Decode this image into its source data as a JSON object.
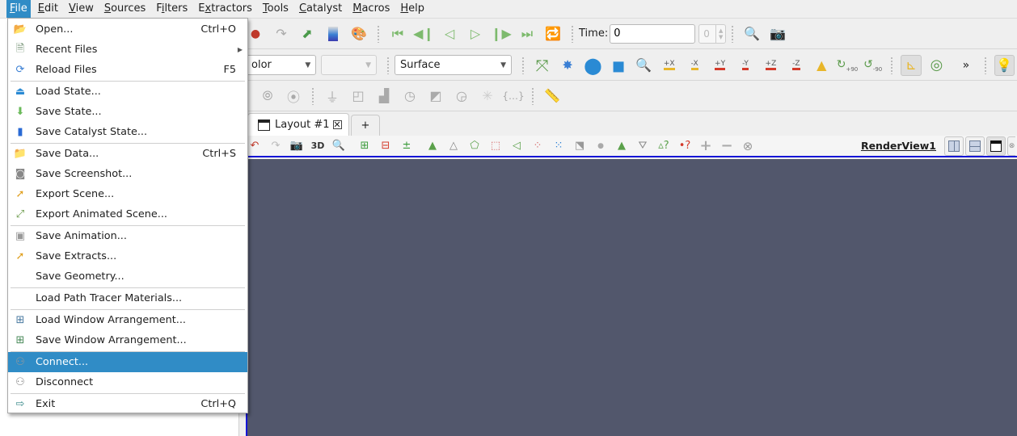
{
  "menubar": {
    "items": [
      {
        "label": "File",
        "mnemonic": "F",
        "active": true
      },
      {
        "label": "Edit",
        "mnemonic": "E"
      },
      {
        "label": "View",
        "mnemonic": "V"
      },
      {
        "label": "Sources",
        "mnemonic": "S"
      },
      {
        "label": "Filters",
        "mnemonic": "i"
      },
      {
        "label": "Extractors",
        "mnemonic": "x"
      },
      {
        "label": "Tools",
        "mnemonic": "T"
      },
      {
        "label": "Catalyst",
        "mnemonic": "C"
      },
      {
        "label": "Macros",
        "mnemonic": "M"
      },
      {
        "label": "Help",
        "mnemonic": "H"
      }
    ]
  },
  "file_menu": {
    "items": [
      {
        "label": "Open...",
        "shortcut": "Ctrl+O",
        "icon": "folder-open-icon"
      },
      {
        "label": "Recent Files",
        "shortcut": "",
        "icon": "recent-files-icon",
        "submenu": true
      },
      {
        "label": "Reload Files",
        "shortcut": "F5",
        "icon": "reload-files-icon"
      },
      {
        "separator": true
      },
      {
        "label": "Load State...",
        "shortcut": "",
        "icon": "load-state-icon"
      },
      {
        "label": "Save State...",
        "shortcut": "",
        "icon": "save-state-icon"
      },
      {
        "label": "Save Catalyst State...",
        "shortcut": "",
        "icon": "catalyst-state-icon"
      },
      {
        "separator": true
      },
      {
        "label": "Save Data...",
        "shortcut": "Ctrl+S",
        "icon": "save-data-icon"
      },
      {
        "label": "Save Screenshot...",
        "shortcut": "",
        "icon": "camera-icon"
      },
      {
        "label": "Export Scene...",
        "shortcut": "",
        "icon": "export-scene-icon"
      },
      {
        "label": "Export Animated Scene...",
        "shortcut": "",
        "icon": "export-animated-scene-icon"
      },
      {
        "separator": true
      },
      {
        "label": "Save Animation...",
        "shortcut": "",
        "icon": "save-animation-icon"
      },
      {
        "label": "Save Extracts...",
        "shortcut": "",
        "icon": "save-extracts-icon"
      },
      {
        "label": "Save Geometry...",
        "shortcut": "",
        "icon": ""
      },
      {
        "separator": true
      },
      {
        "label": "Load Path Tracer Materials...",
        "shortcut": "",
        "icon": ""
      },
      {
        "separator": true
      },
      {
        "label": "Load Window Arrangement...",
        "shortcut": "",
        "icon": "load-window-arrangement-icon"
      },
      {
        "label": "Save Window Arrangement...",
        "shortcut": "",
        "icon": "save-window-arrangement-icon"
      },
      {
        "separator": true
      },
      {
        "label": "Connect...",
        "shortcut": "",
        "icon": "connect-icon",
        "highlighted": true
      },
      {
        "label": "Disconnect",
        "shortcut": "",
        "icon": "disconnect-icon"
      },
      {
        "separator": true
      },
      {
        "label": "Exit",
        "shortcut": "Ctrl+Q",
        "icon": "exit-icon"
      }
    ]
  },
  "toolbar_time": {
    "label": "Time:",
    "value": "0",
    "index_value": "0"
  },
  "toolbar_representation": {
    "color_by_value": "olor",
    "component_value": "",
    "representation_value": "Surface"
  },
  "view_axes": {
    "plus_x": "+X",
    "minus_x": "-X",
    "plus_y": "+Y",
    "minus_y": "-Y",
    "plus_z": "+Z",
    "minus_z": "-Z",
    "rot_plus": "+90",
    "rot_minus": "-90",
    "more": "»"
  },
  "layout_tabs": {
    "tabs": [
      {
        "label": "Layout #1"
      }
    ],
    "add_label": "+"
  },
  "viewbar": {
    "three_d_label": "3D",
    "view_name": "RenderView1"
  },
  "colors": {
    "menu_highlight": "#308cc6",
    "render_background": "#52576c",
    "active_view_border": "#1515d6"
  }
}
